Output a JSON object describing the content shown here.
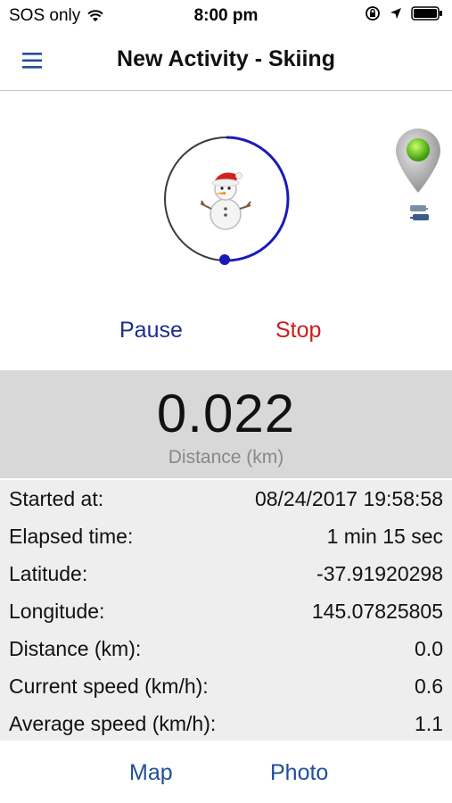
{
  "status_bar": {
    "carrier": "SOS only",
    "time": "8:00 pm",
    "icons": [
      "wifi-icon",
      "rotation-lock-icon",
      "location-arrow-icon",
      "battery-icon"
    ]
  },
  "nav": {
    "title": "New Activity - Skiing",
    "menu_icon": "hamburger-menu-icon"
  },
  "activity": {
    "avatar_icon": "snowman-icon",
    "gps_icon": "gps-pin-green-icon",
    "sync_icon": "sync-icon",
    "pause_label": "Pause",
    "stop_label": "Stop"
  },
  "distance": {
    "value": "0.022",
    "label": "Distance (km)"
  },
  "stats": [
    {
      "label": "Started at:",
      "value": "08/24/2017 19:58:58"
    },
    {
      "label": "Elapsed time:",
      "value": "1 min 15 sec"
    },
    {
      "label": "Latitude:",
      "value": "-37.91920298"
    },
    {
      "label": "Longitude:",
      "value": "145.07825805"
    },
    {
      "label": "Distance (km):",
      "value": "0.0"
    },
    {
      "label": "Current speed (km/h):",
      "value": "0.6"
    },
    {
      "label": "Average speed (km/h):",
      "value": "1.1"
    }
  ],
  "bottom": {
    "map_label": "Map",
    "photo_label": "Photo"
  },
  "colors": {
    "accent_blue": "#1f2d8f",
    "link_blue": "#1f4e9c",
    "stop_red": "#c81e1e",
    "ring_blue": "#1a1ab8",
    "panel_grey": "#d8d8d8",
    "stats_grey": "#eeeeee"
  }
}
